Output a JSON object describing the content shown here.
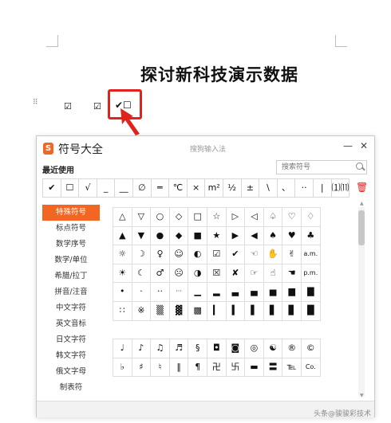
{
  "document": {
    "title": "探讨新科技演示数据",
    "drag_handle": "⠿",
    "checkbox_1": "☑",
    "checkbox_2": "☑",
    "selection_text": "✔☐"
  },
  "dialog": {
    "title": "符号大全",
    "logo_text": "S",
    "ime_title": "搜狗输入法",
    "minimize_label": "—",
    "close_label": "✕",
    "recent_label": "最近使用",
    "search_placeholder": "搜索符号",
    "recent_symbols": [
      "✔",
      "☐",
      "√",
      "_",
      "__",
      "∅",
      "═",
      "℃",
      "×",
      "m²",
      "½",
      "±",
      "\\",
      "、",
      "··",
      "|",
      "⑴⑾"
    ],
    "categories": [
      {
        "label": "特殊符号",
        "active": true
      },
      {
        "label": "标点符号",
        "active": false
      },
      {
        "label": "数学序号",
        "active": false
      },
      {
        "label": "数学/单位",
        "active": false
      },
      {
        "label": "希腊/拉丁",
        "active": false
      },
      {
        "label": "拼音/注音",
        "active": false
      },
      {
        "label": "中文字符",
        "active": false
      },
      {
        "label": "英文音标",
        "active": false
      },
      {
        "label": "日文字符",
        "active": false
      },
      {
        "label": "韩文字符",
        "active": false
      },
      {
        "label": "俄文字母",
        "active": false
      },
      {
        "label": "制表符",
        "active": false
      }
    ],
    "symbol_rows": [
      [
        "△",
        "▽",
        "○",
        "◇",
        "□",
        "☆",
        "▷",
        "◁",
        "♤",
        "♡",
        "♢"
      ],
      [
        "▲",
        "▼",
        "●",
        "◆",
        "■",
        "★",
        "▶",
        "◀",
        "♠",
        "♥",
        "♣"
      ],
      [
        "☼",
        "☽",
        "♀",
        "☺",
        "◐",
        "☑",
        "✔",
        "☜",
        "✋",
        "✌",
        "a.m."
      ],
      [
        "☀",
        "☾",
        "♂",
        "☹",
        "◑",
        "☒",
        "✘",
        "☞",
        "☝",
        "☚",
        "p.m."
      ],
      [
        "•",
        "·",
        "··",
        "···",
        "▁",
        "▂",
        "▃",
        "▄",
        "▅",
        "▆",
        "▇"
      ],
      [
        "∷",
        "※",
        "▒",
        "▓",
        "▩",
        "▎",
        "▍",
        "▌",
        "▋",
        "▊",
        "█"
      ],
      [
        "",
        "",
        "",
        "",
        "",
        "",
        "",
        "",
        "",
        "",
        ""
      ],
      [
        "♩",
        "♪",
        "♫",
        "♬",
        "§",
        "◘",
        "◙",
        "◎",
        "☯",
        "®",
        "©"
      ],
      [
        "♭",
        "♯",
        "♮",
        "‖",
        "¶",
        "卍",
        "卐",
        "▬",
        "〓",
        "℡",
        "™"
      ]
    ],
    "symbol_row8_last": "Co.",
    "trash_icon": "🗑"
  },
  "watermark": "头条@骏骏彩技术"
}
